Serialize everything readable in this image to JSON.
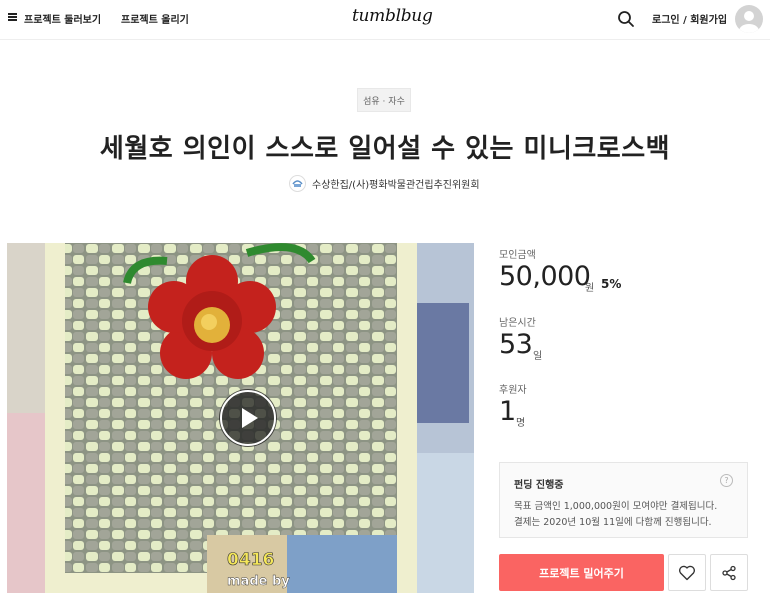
{
  "header": {
    "browse_label": "프로젝트 둘러보기",
    "upload_label": "프로젝트 올리기",
    "logo_text": "tumblbug",
    "login_label": "로그인 / 회원가입"
  },
  "project": {
    "category": "섬유 · 자수",
    "title": "세월호 의인이 스스로 일어설 수 있는 미니크로스백",
    "creator": "수상한집/(사)평화박물관건립추진위원회"
  },
  "media": {
    "caption_line1": "0416",
    "caption_line2": "made by"
  },
  "stats": {
    "amount_label": "모인금액",
    "amount_value": "50,000",
    "amount_unit": "원",
    "percent": "5%",
    "time_label": "남은시간",
    "time_value": "53",
    "time_unit": "일",
    "backers_label": "후원자",
    "backers_value": "1",
    "backers_unit": "명"
  },
  "funding": {
    "title": "펀딩 진행중",
    "line1": "목표 금액인 1,000,000원이 모여야만 결제됩니다.",
    "line2": "결제는 2020년 10월 11일에 다함께 진행됩니다.",
    "help": "?"
  },
  "actions": {
    "fund_label": "프로젝트 밀어주기"
  },
  "colors": {
    "accent": "#fa6462"
  }
}
